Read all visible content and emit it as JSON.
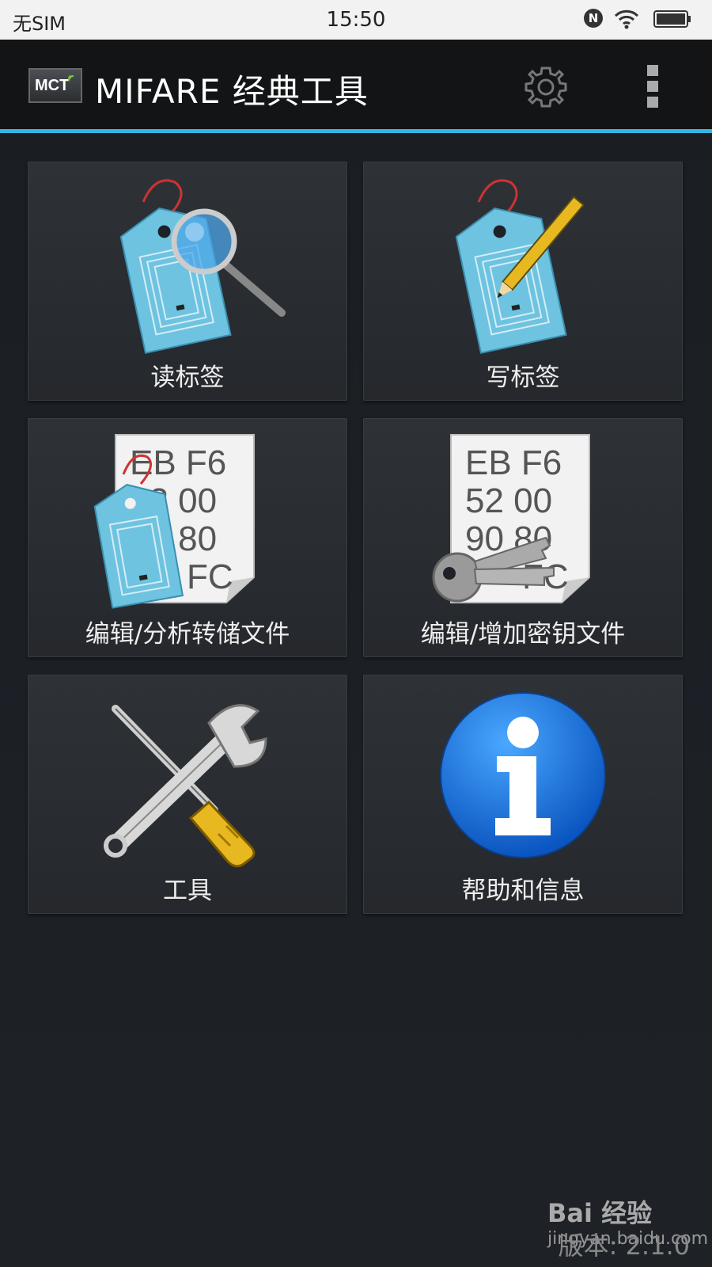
{
  "status_bar": {
    "carrier": "无SIM",
    "time": "15:50",
    "nfc": "N"
  },
  "app_bar": {
    "logo_text": "MCT",
    "title": "MIFARE 经典工具",
    "icons": [
      "settings-icon",
      "overflow-menu-icon"
    ],
    "accent_color": "#33b5e5"
  },
  "tiles": [
    {
      "label": "读标签",
      "icon": "read-tag-icon"
    },
    {
      "label": "写标签",
      "icon": "write-tag-icon"
    },
    {
      "label": "编辑/分析转储文件",
      "icon": "dump-editor-icon"
    },
    {
      "label": "编辑/增加密钥文件",
      "icon": "key-editor-icon"
    },
    {
      "label": "工具",
      "icon": "tools-icon"
    },
    {
      "label": "帮助和信息",
      "icon": "info-icon"
    }
  ],
  "dump_preview": [
    "EB F6",
    "52 00",
    "90 80",
    "FC"
  ],
  "version": "版本: 2.1.0",
  "watermark": {
    "brand": "Bai 经验",
    "url": "jingyan.baidu.com"
  }
}
